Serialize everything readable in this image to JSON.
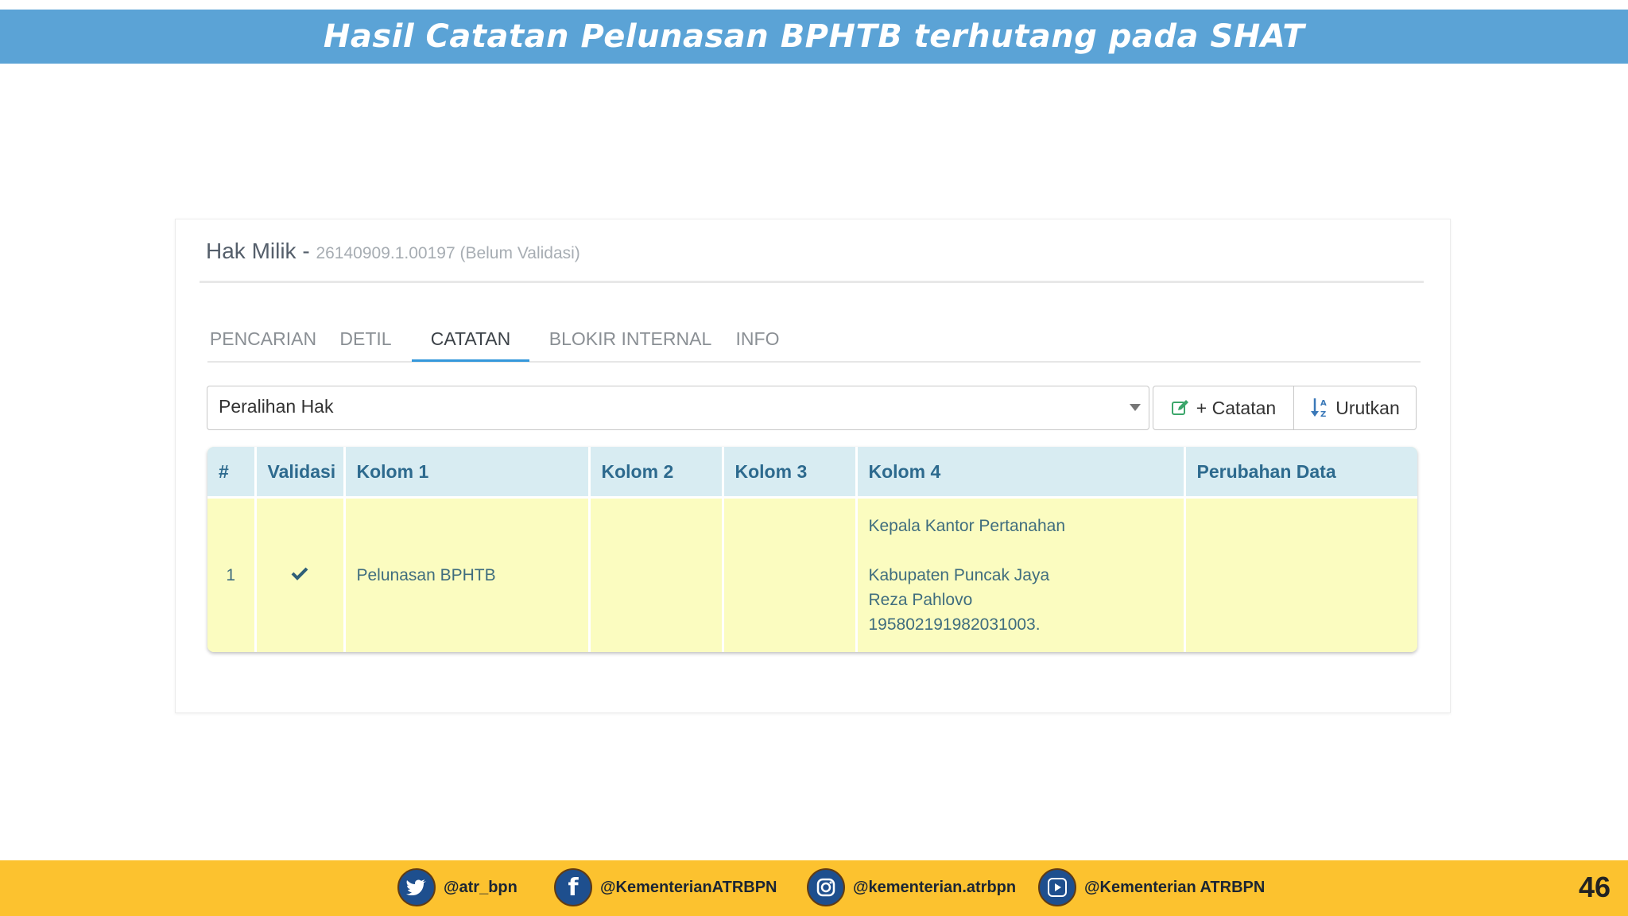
{
  "slide": {
    "title": "Hasil Catatan Pelunasan BPHTB terhutang pada SHAT"
  },
  "panel": {
    "title": "Hak Milik -",
    "subtitle": "26140909.1.00197 (Belum Validasi)"
  },
  "tabs": [
    {
      "label": "PENCARIAN",
      "active": false
    },
    {
      "label": "DETIL",
      "active": false
    },
    {
      "label": "CATATAN",
      "active": true
    },
    {
      "label": "BLOKIR INTERNAL",
      "active": false
    },
    {
      "label": "INFO",
      "active": false
    }
  ],
  "filter": {
    "selected": "Peralihan Hak"
  },
  "buttons": {
    "add_catatan": "+ Catatan",
    "sort": "Urutkan"
  },
  "table": {
    "headers": [
      "#",
      "Validasi",
      "Kolom 1",
      "Kolom 2",
      "Kolom 3",
      "Kolom 4",
      "Perubahan Data"
    ],
    "rows": [
      {
        "num": "1",
        "validated": true,
        "kolom1": "Pelunasan BPHTB",
        "kolom2": "",
        "kolom3": "",
        "kolom4": [
          "Kepala Kantor Pertanahan",
          "",
          "Kabupaten Puncak Jaya",
          "Reza Pahlovo",
          "195802191982031003."
        ],
        "perubahan": ""
      }
    ]
  },
  "footer": {
    "socials": [
      {
        "icon": "twitter-icon",
        "handle": "@atr_bpn"
      },
      {
        "icon": "facebook-icon",
        "handle": "@KementerianATRBPN"
      },
      {
        "icon": "instagram-icon",
        "handle": "@kementerian.atrbpn"
      },
      {
        "icon": "youtube-icon",
        "handle": "@Kementerian ATRBPN"
      }
    ],
    "page_number": "46"
  },
  "colors": {
    "header_bg": "#5ba3d6",
    "footer_bg": "#fcc22f",
    "tab_active": "#3498db",
    "row_bg": "#fbfcc0",
    "table_header_bg": "#d8ecf2"
  }
}
